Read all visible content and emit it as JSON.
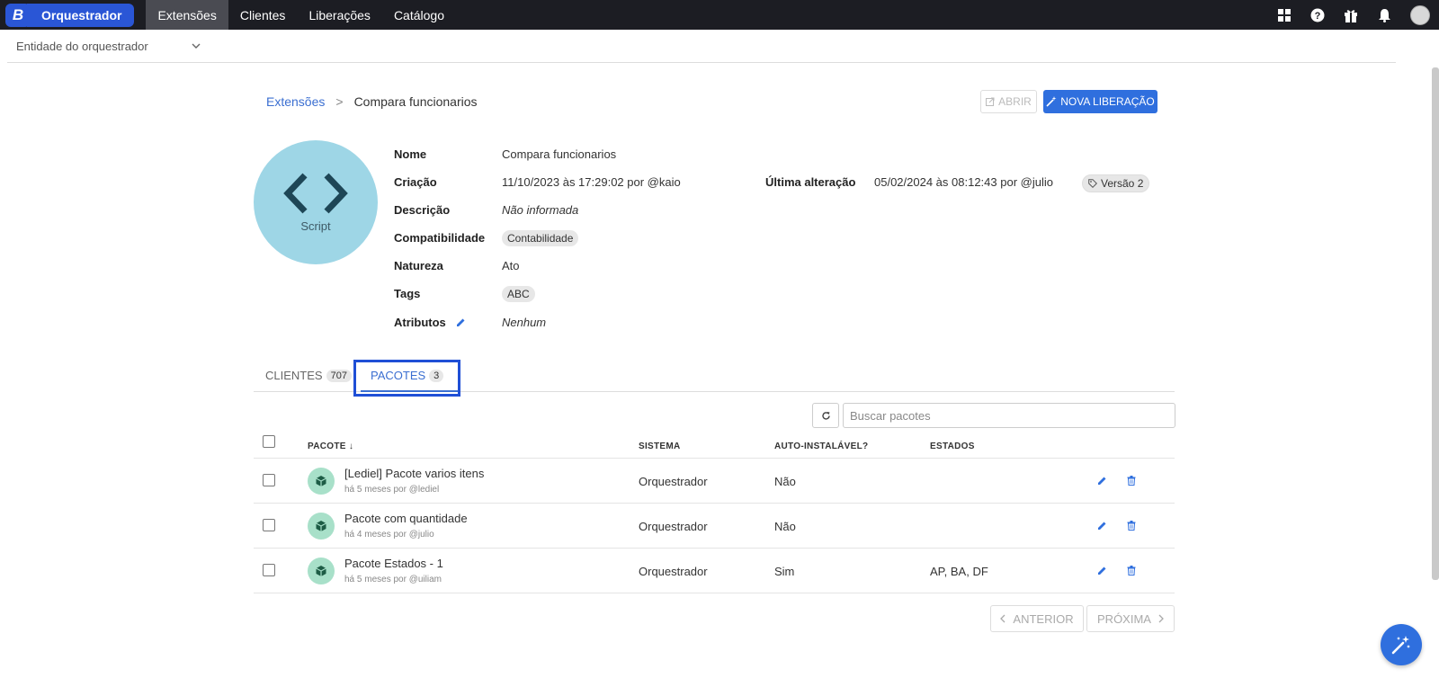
{
  "topbar": {
    "logo_letter": "B",
    "brand": "Orquestrador",
    "tabs": [
      {
        "label": "Extensões",
        "active": true
      },
      {
        "label": "Clientes",
        "active": false
      },
      {
        "label": "Liberações",
        "active": false
      },
      {
        "label": "Catálogo",
        "active": false
      }
    ],
    "icons": [
      "apps-grid-icon",
      "help-icon",
      "gift-icon",
      "bell-icon",
      "user-avatar"
    ]
  },
  "entity_select": {
    "value": "Entidade do orquestrador"
  },
  "breadcrumb": {
    "parent": "Extensões",
    "separator": ">",
    "current": "Compara funcionarios"
  },
  "actions": {
    "open_label": "ABRIR",
    "new_release_label": "NOVA LIBERAÇÃO"
  },
  "extension": {
    "type_label": "Script",
    "fields": {
      "nome_label": "Nome",
      "nome": "Compara funcionarios",
      "criacao_label": "Criação",
      "criacao": "11/10/2023 às 17:29:02 por @kaio",
      "ultima_label": "Última alteração",
      "ultima": "05/02/2024 às 08:12:43 por @julio",
      "versao": "Versão 2",
      "descricao_label": "Descrição",
      "descricao": "Não informada",
      "compat_label": "Compatibilidade",
      "compat": "Contabilidade",
      "natureza_label": "Natureza",
      "natureza": "Ato",
      "tags_label": "Tags",
      "tags": "ABC",
      "atributos_label": "Atributos",
      "atributos": "Nenhum"
    }
  },
  "tabs": {
    "clientes_label": "CLIENTES",
    "clientes_count": "707",
    "pacotes_label": "PACOTES",
    "pacotes_count": "3"
  },
  "search": {
    "placeholder": "Buscar pacotes"
  },
  "table": {
    "headers": {
      "pacote": "PACOTE",
      "sort_arrow": "↓",
      "sistema": "SISTEMA",
      "auto": "AUTO-INSTALÁVEL?",
      "estados": "ESTADOS"
    },
    "rows": [
      {
        "name": "[Lediel] Pacote varios itens",
        "sub": "há 5 meses por @lediel",
        "sistema": "Orquestrador",
        "auto": "Não",
        "estados": ""
      },
      {
        "name": "Pacote com quantidade",
        "sub": "há 4 meses por @julio",
        "sistema": "Orquestrador",
        "auto": "Não",
        "estados": ""
      },
      {
        "name": "Pacote Estados - 1",
        "sub": "há 5 meses por @uiliam",
        "sistema": "Orquestrador",
        "auto": "Sim",
        "estados": "AP, BA, DF"
      }
    ]
  },
  "pagination": {
    "prev": "ANTERIOR",
    "next": "PRÓXIMA"
  },
  "colors": {
    "primary": "#2f6fde",
    "topbar": "#1c1d23",
    "highlight": "#1f4fd6"
  }
}
